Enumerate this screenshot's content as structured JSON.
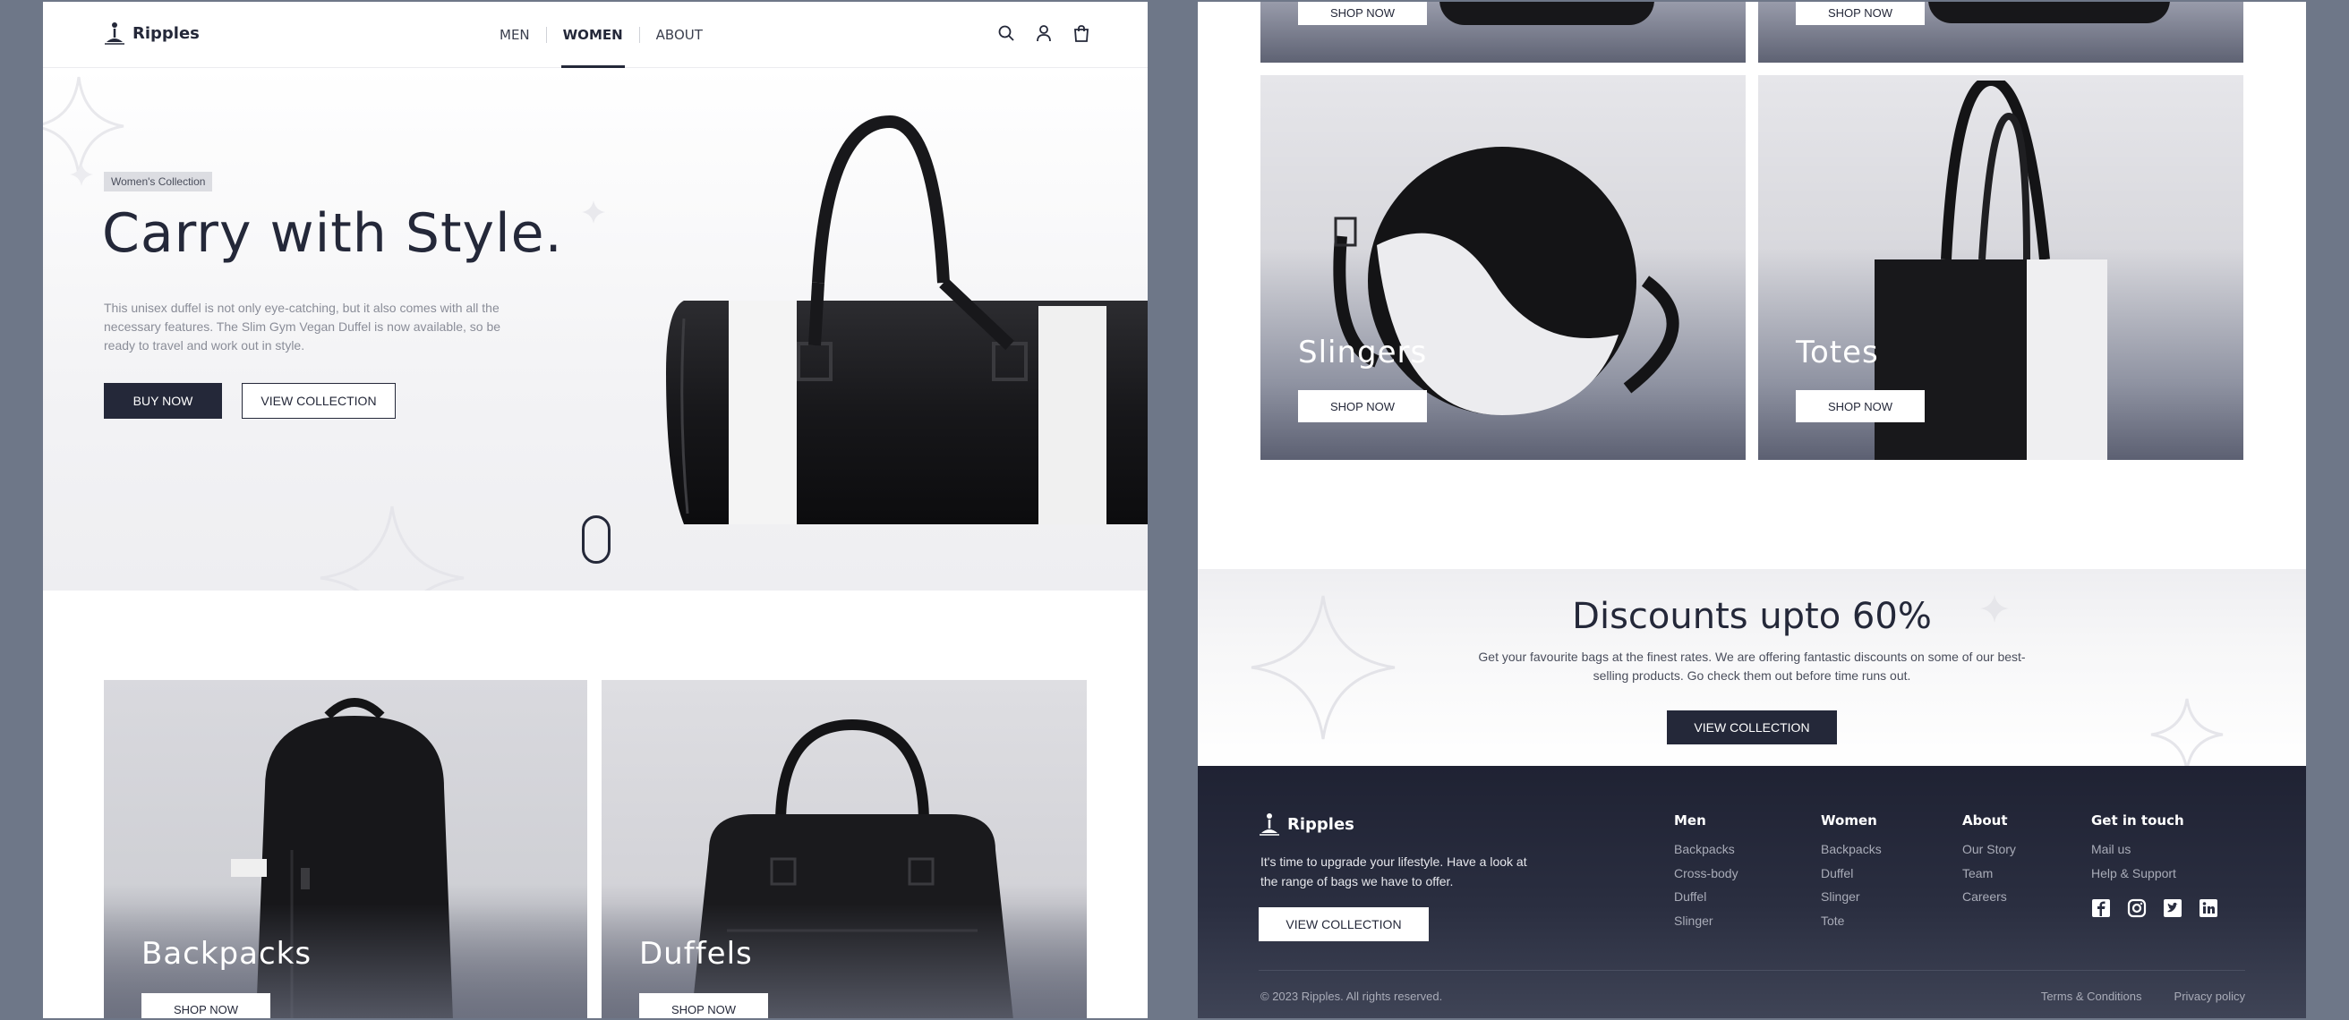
{
  "brand": {
    "name": "Ripples"
  },
  "nav": {
    "links": [
      {
        "label": "MEN",
        "active": false
      },
      {
        "label": "WOMEN",
        "active": true
      },
      {
        "label": "ABOUT",
        "active": false
      }
    ],
    "icons": [
      "search-icon",
      "user-icon",
      "shopping-bag-icon"
    ]
  },
  "hero": {
    "badge": "Women's Collection",
    "title": "Carry with Style.",
    "description": "This unisex duffel is not only eye-catching, but it also comes with all the necessary features. The Slim Gym Vegan Duffel is now available, so be ready to travel and work out in style.",
    "buy_label": "BUY NOW",
    "view_label": "VIEW COLLECTION"
  },
  "categories": [
    {
      "name": "Backpacks",
      "cta": "SHOP NOW"
    },
    {
      "name": "Duffels",
      "cta": "SHOP NOW"
    },
    {
      "name": "Slingers",
      "cta": "SHOP NOW"
    },
    {
      "name": "Totes",
      "cta": "SHOP NOW"
    }
  ],
  "top_cropped_cta": [
    "SHOP NOW",
    "SHOP NOW"
  ],
  "discount": {
    "title": "Discounts upto 60%",
    "description": "Get your favourite bags at the finest rates. We are offering fantastic discounts on some of our best-selling products. Go check them out before time runs out.",
    "cta": "VIEW COLLECTION"
  },
  "footer": {
    "tagline": "It's time to upgrade your lifestyle. Have a look at the range of bags we have to offer.",
    "cta": "VIEW COLLECTION",
    "columns": [
      {
        "title": "Men",
        "links": [
          "Backpacks",
          "Cross-body",
          "Duffel",
          "Slinger"
        ]
      },
      {
        "title": "Women",
        "links": [
          "Backpacks",
          "Duffel",
          "Slinger",
          "Tote"
        ]
      },
      {
        "title": "About",
        "links": [
          "Our Story",
          "Team",
          "Careers"
        ]
      },
      {
        "title": "Get in touch",
        "links": [
          "Mail us",
          "Help & Support"
        ]
      }
    ],
    "social": [
      "facebook-icon",
      "instagram-icon",
      "twitter-icon",
      "linkedin-icon"
    ],
    "copyright": "© 2023 Ripples. All rights reserved.",
    "legal": [
      "Terms & Conditions",
      "Privacy policy"
    ]
  },
  "colors": {
    "primary": "#242839",
    "backdrop": "#6e7788",
    "footer_bg": "#1f2233",
    "muted_text": "#8a8d98"
  }
}
